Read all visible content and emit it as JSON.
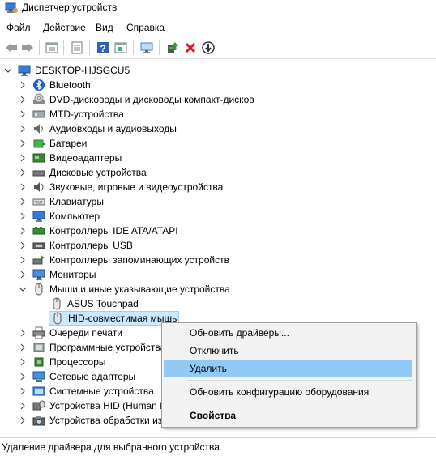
{
  "window": {
    "title": "Диспетчер устройств"
  },
  "menu": [
    "Файл",
    "Действие",
    "Вид",
    "Справка"
  ],
  "toolbar": {
    "icons": [
      "back-arrow-icon",
      "forward-arrow-icon",
      "properties-icon",
      "list-view-icon",
      "help-icon",
      "show-hidden-icon",
      "scan-hardware-icon",
      "update-driver-icon",
      "uninstall-icon",
      "disable-icon"
    ]
  },
  "tree": {
    "root": "DESKTOP-HJSGCU5",
    "items": [
      {
        "label": "Bluetooth",
        "icon": "bluetooth-icon"
      },
      {
        "label": "DVD-дисководы и дисководы компакт-дисков",
        "icon": "dvd-drive-icon"
      },
      {
        "label": "MTD-устройства",
        "icon": "mtd-device-icon"
      },
      {
        "label": "Аудиовходы и аудиовыходы",
        "icon": "audio-io-icon"
      },
      {
        "label": "Батареи",
        "icon": "battery-icon"
      },
      {
        "label": "Видеоадаптеры",
        "icon": "display-adapter-icon"
      },
      {
        "label": "Дисковые устройства",
        "icon": "disk-drive-icon"
      },
      {
        "label": "Звуковые, игровые и видеоустройства",
        "icon": "sound-device-icon"
      },
      {
        "label": "Клавиатуры",
        "icon": "keyboard-icon"
      },
      {
        "label": "Компьютер",
        "icon": "computer-icon"
      },
      {
        "label": "Контроллеры IDE ATA/ATAPI",
        "icon": "ide-controller-icon"
      },
      {
        "label": "Контроллеры USB",
        "icon": "usb-controller-icon"
      },
      {
        "label": "Контроллеры запоминающих устройств",
        "icon": "storage-controller-icon"
      },
      {
        "label": "Мониторы",
        "icon": "monitor-icon"
      },
      {
        "label": "Мыши и иные указывающие устройства",
        "icon": "mouse-icon",
        "expanded": true,
        "children": [
          "ASUS Touchpad",
          "HID-совместимая мышь"
        ]
      },
      {
        "label": "Очереди печати",
        "icon": "printer-icon"
      },
      {
        "label": "Программные устройства",
        "icon": "software-device-icon"
      },
      {
        "label": "Процессоры",
        "icon": "processor-icon"
      },
      {
        "label": "Сетевые адаптеры",
        "icon": "network-adapter-icon"
      },
      {
        "label": "Системные устройства",
        "icon": "system-device-icon"
      },
      {
        "label": "Устройства HID (Human Interface Devices)",
        "icon": "hid-device-icon"
      },
      {
        "label": "Устройства обработки изображений",
        "icon": "imaging-device-icon"
      }
    ]
  },
  "context_menu": {
    "items": [
      "Обновить драйверы...",
      "Отключить",
      "Удалить",
      "Обновить конфигурацию оборудования",
      "Свойства"
    ]
  },
  "status": {
    "text": "Удаление драйвера для выбранного устройства."
  },
  "colors": {
    "selection": "#cce8ff",
    "menu_highlight": "#91c9f7",
    "uninstall_red": "#e81123"
  }
}
